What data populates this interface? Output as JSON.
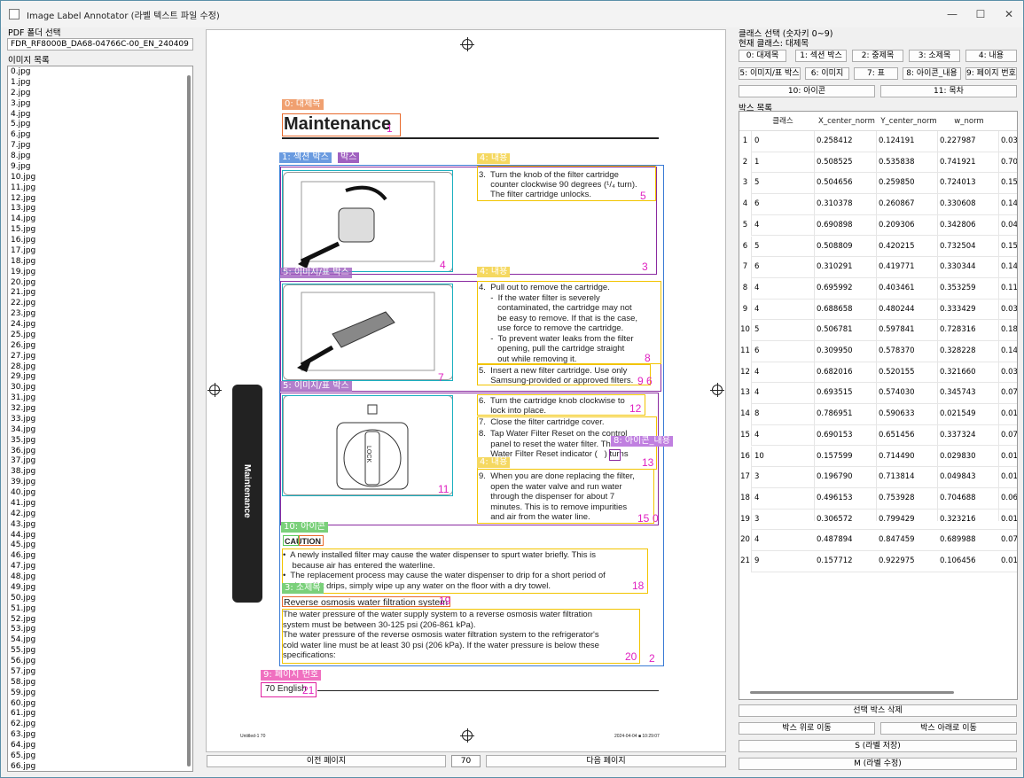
{
  "window": {
    "title": "Image Label Annotator (라벨 텍스트 파일 수정)",
    "minimize": "—",
    "maximize": "☐",
    "close": "✕"
  },
  "left": {
    "folder_label": "PDF 폴더 선택",
    "folder_value": "FDR_RF8000B_DA68-04766C-00_EN_240409",
    "list_label": "이미지 목록",
    "images": [
      "0.jpg",
      "1.jpg",
      "2.jpg",
      "3.jpg",
      "4.jpg",
      "5.jpg",
      "6.jpg",
      "7.jpg",
      "8.jpg",
      "9.jpg",
      "10.jpg",
      "11.jpg",
      "12.jpg",
      "13.jpg",
      "14.jpg",
      "15.jpg",
      "16.jpg",
      "17.jpg",
      "18.jpg",
      "19.jpg",
      "20.jpg",
      "21.jpg",
      "22.jpg",
      "23.jpg",
      "24.jpg",
      "25.jpg",
      "26.jpg",
      "27.jpg",
      "28.jpg",
      "29.jpg",
      "30.jpg",
      "31.jpg",
      "32.jpg",
      "33.jpg",
      "34.jpg",
      "35.jpg",
      "36.jpg",
      "37.jpg",
      "38.jpg",
      "39.jpg",
      "40.jpg",
      "41.jpg",
      "42.jpg",
      "43.jpg",
      "44.jpg",
      "45.jpg",
      "46.jpg",
      "47.jpg",
      "48.jpg",
      "49.jpg",
      "50.jpg",
      "51.jpg",
      "52.jpg",
      "53.jpg",
      "54.jpg",
      "55.jpg",
      "56.jpg",
      "57.jpg",
      "58.jpg",
      "59.jpg",
      "60.jpg",
      "61.jpg",
      "62.jpg",
      "63.jpg",
      "64.jpg",
      "65.jpg",
      "66.jpg"
    ]
  },
  "nav": {
    "prev": "이전 페이지",
    "page": "70",
    "next": "다음 페이지"
  },
  "doc": {
    "heading": "Maintenance",
    "sidebar_label": "Maintenance",
    "step3": "3.  Turn the knob of the filter cartridge\n     counter clockwise 90 degrees (¹/₄ turn).\n     The filter cartridge unlocks.",
    "step4": "4.  Pull out to remove the cartridge.\n     -  If the water filter is severely\n        contaminated, the cartridge may not\n        be easy to remove. If that is the case,\n        use force to remove the cartridge.\n     -  To prevent water leaks from the filter\n        opening, pull the cartridge straight\n        out while removing it.",
    "step5": "5.  Insert a new filter cartridge. Use only\n     Samsung-provided or approved filters.",
    "step6": "6.  Turn the cartridge knob clockwise to\n     lock into place.",
    "step7": "7.  Close the filter cartridge cover.",
    "step8": "8.  Tap Water Filter Reset on the control\n     panel to reset the water filter. The red\n     Water Filter Reset indicator (   ) turns\n     off.",
    "step9": "9.  When you are done replacing the filter,\n     open the water valve and run water\n     through the dispenser for about 7\n     minutes. This is to remove impurities\n     and air from the water line.",
    "caution_title": "CAUTION",
    "caution": "•  A newly installed filter may cause the water dispenser to spurt water briefly. This is\n    because air has entered the waterline.\n•  The replacement process may cause the water dispenser to drip for a short period of\n    time. If it drips, simply wipe up any water on the floor with a dry towel.",
    "ro_title": "Reverse osmosis water filtration system",
    "ro_text": "The water pressure of the water supply system to a reverse osmosis water filtration\nsystem must be between 30-125 psi (206-861 kPa).\nThe water pressure of the reverse osmosis water filtration system to the refrigerator's\ncold water line must be at least 30 psi (206 kPa). If the water pressure is below these\nspecifications:",
    "footer_page": "70   English",
    "print_left": "Untitled-1   70",
    "print_right": "2024-04-04   ■ 10:29:07",
    "tags": {
      "t0": "0: 대제목",
      "t1": "1: 섹션 박스",
      "t1b": "박스",
      "t4a": "4: 내용",
      "t4b": "4: 내용",
      "t5": "5: 이미지/표 박스",
      "t5b": "5: 이미지/표 박스",
      "t8": "8: 아이콘_내용",
      "t4c": "4: 내용",
      "t10": "10: 아이콘",
      "t3": "3: 소제목",
      "t9": "9: 페이지 번호",
      "t4d": "4: 내용"
    },
    "nums": {
      "n1": "1",
      "n5": "5",
      "n4": "4",
      "n3": "3",
      "n8": "8",
      "n96": "9 6",
      "n7": "7",
      "n12": "12",
      "n13": "13",
      "n11": "11",
      "n15": "15",
      "n10": "0",
      "n18": "18",
      "n19": "19",
      "n20": "20",
      "n2": "2",
      "n21": "21"
    },
    "lock_text": "LOCK"
  },
  "right": {
    "class_label": "클래스 선택 (숫자키 0~9)",
    "current_class": "현재 클래스: 대제목",
    "classes": [
      "0: 대제목",
      "1: 섹션 박스",
      "2: 중제목",
      "3: 소제목",
      "4: 내용",
      "5: 이미지/표 박스",
      "6: 이미지",
      "7: 표",
      "8: 아이콘_내용",
      "9: 페이지 번호",
      "10: 아이콘",
      "11: 목차"
    ],
    "box_list_label": "박스 목록",
    "columns": [
      "클래스",
      "X_center_norm",
      "Y_center_norm",
      "w_norm",
      ""
    ],
    "rows": [
      [
        "0",
        "0.258412",
        "0.124191",
        "0.227987",
        "0.03"
      ],
      [
        "1",
        "0.508525",
        "0.535838",
        "0.741921",
        "0.70"
      ],
      [
        "5",
        "0.504656",
        "0.259850",
        "0.724013",
        "0.15"
      ],
      [
        "6",
        "0.310378",
        "0.260867",
        "0.330608",
        "0.14"
      ],
      [
        "4",
        "0.690898",
        "0.209306",
        "0.342806",
        "0.04"
      ],
      [
        "5",
        "0.508809",
        "0.420215",
        "0.732504",
        "0.15"
      ],
      [
        "6",
        "0.310291",
        "0.419771",
        "0.330344",
        "0.14"
      ],
      [
        "4",
        "0.695992",
        "0.403461",
        "0.353259",
        "0.11"
      ],
      [
        "4",
        "0.688658",
        "0.480244",
        "0.333429",
        "0.03"
      ],
      [
        "5",
        "0.506781",
        "0.597841",
        "0.728316",
        "0.18"
      ],
      [
        "6",
        "0.309950",
        "0.578370",
        "0.328228",
        "0.14"
      ],
      [
        "4",
        "0.682016",
        "0.520155",
        "0.321660",
        "0.03"
      ],
      [
        "4",
        "0.693515",
        "0.574030",
        "0.345743",
        "0.07"
      ],
      [
        "8",
        "0.786951",
        "0.590633",
        "0.021549",
        "0.01"
      ],
      [
        "4",
        "0.690153",
        "0.651456",
        "0.337324",
        "0.07"
      ],
      [
        "10",
        "0.157599",
        "0.714490",
        "0.029830",
        "0.01"
      ],
      [
        "3",
        "0.196790",
        "0.713814",
        "0.049843",
        "0.01"
      ],
      [
        "4",
        "0.496153",
        "0.753928",
        "0.704688",
        "0.06"
      ],
      [
        "3",
        "0.306572",
        "0.799429",
        "0.323216",
        "0.01"
      ],
      [
        "4",
        "0.487894",
        "0.847459",
        "0.689988",
        "0.07"
      ],
      [
        "9",
        "0.157712",
        "0.922975",
        "0.106456",
        "0.01"
      ]
    ],
    "delete_btn": "선택 박스 삭제",
    "up_btn": "박스 위로 이동",
    "down_btn": "박스 아래로 이동",
    "save_btn": "S (라벨 저장)",
    "modify_btn": "M (라벨 수정)"
  },
  "colors": {
    "section": "#3a7bd5",
    "content": "#f2c400",
    "image_box": "#8a2aa0",
    "image": "#1ab0c0",
    "title": "#e86a2c",
    "icon": "#5ac85a",
    "page": "#e020a0"
  }
}
